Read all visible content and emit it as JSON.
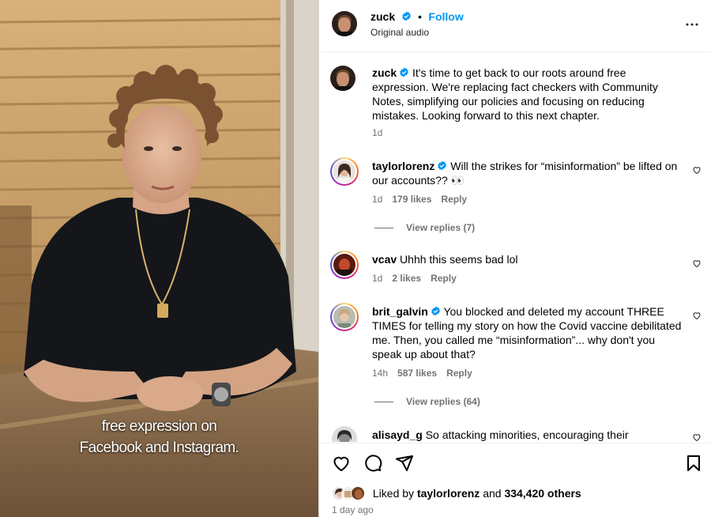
{
  "video": {
    "caption_lines": [
      "free expression on",
      "Facebook and Instagram."
    ]
  },
  "header": {
    "username": "zuck",
    "follow_label": "Follow",
    "separator": "•",
    "subtitle": "Original audio",
    "more_icon": "more-horizontal-icon"
  },
  "post": {
    "username": "zuck",
    "text": "It's time to get back to our roots around free expression. We're replacing fact checkers with Community Notes, simplifying our policies and focusing on reducing mistakes. Looking forward to this next chapter.",
    "time": "1d"
  },
  "comments": [
    {
      "username": "taylorlorenz",
      "verified": true,
      "text": "Will the strikes for “misinformation” be lifted on our accounts?? 👀",
      "time": "1d",
      "likes": "179 likes",
      "reply": "Reply",
      "view_replies": "View replies (7)"
    },
    {
      "username": "vcav",
      "verified": false,
      "text": "Uhhh this seems bad lol",
      "time": "1d",
      "likes": "2 likes",
      "reply": "Reply"
    },
    {
      "username": "brit_galvin",
      "verified": true,
      "text": "You blocked and deleted my account THREE TIMES for telling my story on how the Covid vaccine debilitated me. Then, you called me “misinformation”... why don't you speak up about that?",
      "time": "14h",
      "likes": "587 likes",
      "reply": "Reply",
      "view_replies": "View replies (64)"
    },
    {
      "username": "alisayd_g",
      "verified": false,
      "text": "So attacking minorities, encouraging their"
    }
  ],
  "actions": {
    "icons": [
      "heart-icon",
      "comment-icon",
      "share-icon",
      "bookmark-icon"
    ],
    "liked_prefix": "Liked by",
    "liked_user": "taylorlorenz",
    "liked_and": "and",
    "liked_others": "334,420 others",
    "time_ago": "1 day ago"
  },
  "colors": {
    "link_blue": "#0095f6",
    "verified_blue": "#0095f6",
    "meta_gray": "#737373"
  }
}
